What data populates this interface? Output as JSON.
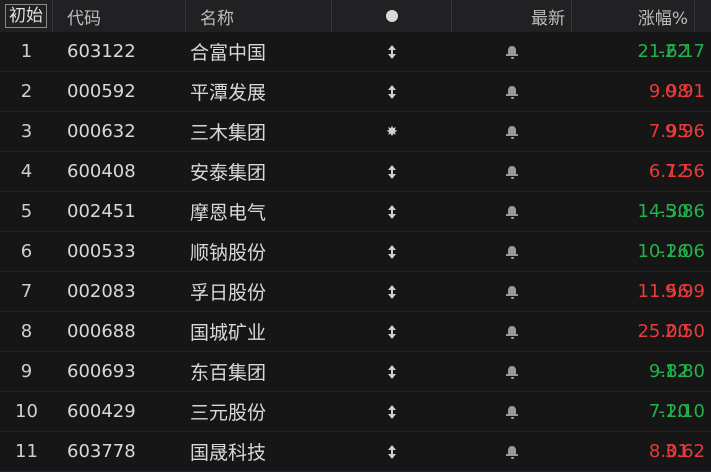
{
  "header": {
    "sort": "初始",
    "code": "代码",
    "name": "名称",
    "latest": "最新",
    "change": "涨幅%"
  },
  "colors": {
    "up": "#e83a3a",
    "down": "#22b14c",
    "background": "#161617",
    "header": "#212124"
  },
  "rows": [
    {
      "idx": "1",
      "code": "603122",
      "name": "合富中国",
      "icon": "updown-icon",
      "price": "21.62",
      "change": "-2.17",
      "dir": "down"
    },
    {
      "idx": "2",
      "code": "000592",
      "name": "平潭发展",
      "icon": "updown-icon",
      "price": "9.98",
      "change": "0.91",
      "dir": "up"
    },
    {
      "idx": "3",
      "code": "000632",
      "name": "三木集团",
      "icon": "sun-icon",
      "price": "7.95",
      "change": "9.96",
      "dir": "up"
    },
    {
      "idx": "4",
      "code": "600408",
      "name": "安泰集团",
      "icon": "updown-icon",
      "price": "6.12",
      "change": "7.56",
      "dir": "up"
    },
    {
      "idx": "5",
      "code": "002451",
      "name": "摩恩电气",
      "icon": "updown-icon",
      "price": "14.30",
      "change": "-5.86",
      "dir": "down"
    },
    {
      "idx": "6",
      "code": "000533",
      "name": "顺钠股份",
      "icon": "updown-icon",
      "price": "10.26",
      "change": "-1.06",
      "dir": "down"
    },
    {
      "idx": "7",
      "code": "002083",
      "name": "孚日股份",
      "icon": "updown-icon",
      "price": "11.56",
      "change": "9.99",
      "dir": "up"
    },
    {
      "idx": "8",
      "code": "000688",
      "name": "国城矿业",
      "icon": "updown-icon",
      "price": "25.00",
      "change": "2.50",
      "dir": "up"
    },
    {
      "idx": "9",
      "code": "600693",
      "name": "东百集团",
      "icon": "updown-icon",
      "price": "9.82",
      "change": "-1.80",
      "dir": "down"
    },
    {
      "idx": "10",
      "code": "600429",
      "name": "三元股份",
      "icon": "updown-icon",
      "price": "7.20",
      "change": "-1.10",
      "dir": "down"
    },
    {
      "idx": "11",
      "code": "603778",
      "name": "国晟科技",
      "icon": "updown-icon",
      "price": "8.01",
      "change": "3.62",
      "dir": "up"
    }
  ]
}
